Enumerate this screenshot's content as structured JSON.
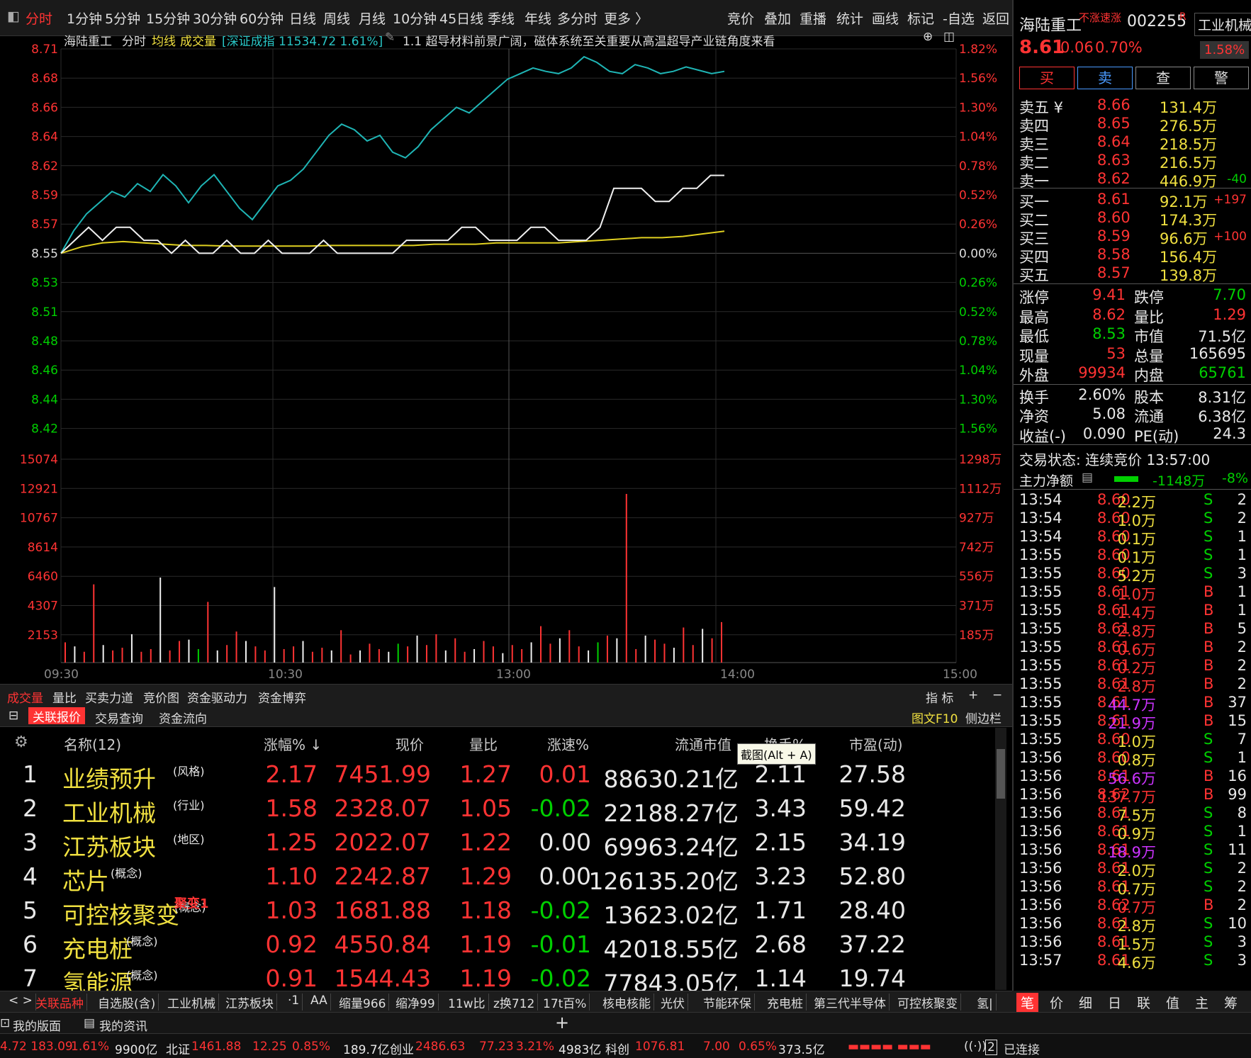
{
  "toolbar": {
    "periods": [
      "分时",
      "1分钟",
      "5分钟",
      "15分钟",
      "30分钟",
      "60分钟",
      "日线",
      "周线",
      "月线",
      "10分钟",
      "45日线",
      "季线",
      "年线",
      "多分时",
      "更多 〉"
    ],
    "actions": [
      "竞价",
      "叠加",
      "重播",
      "统计",
      "画线",
      "标记",
      "-自选",
      "返回"
    ]
  },
  "infobar": {
    "stock": "海陆重工",
    "mode": "分时",
    "avg_label": "均线",
    "vol_label": "成交量",
    "index_info": "[深证成指 11534.72 1.61%]",
    "news": "1.1 超导材料前景广阔，磁体系统至关重要从高温超导产业链角度来看"
  },
  "chart_data": {
    "type": "line",
    "price_axis": [
      "8.71",
      "8.68",
      "8.66",
      "8.64",
      "8.62",
      "8.59",
      "8.57",
      "8.55",
      "8.53",
      "8.51",
      "8.48",
      "8.46",
      "8.44",
      "8.42"
    ],
    "pct_axis": [
      "1.82%",
      "1.56%",
      "1.30%",
      "1.04%",
      "0.78%",
      "0.52%",
      "0.26%",
      "0.00%",
      "0.26%",
      "0.52%",
      "0.78%",
      "1.04%",
      "1.30%",
      "1.56%"
    ],
    "vol_axis": [
      "15074",
      "12921",
      "10767",
      "8614",
      "6460",
      "4307",
      "2153"
    ],
    "vol_axis_right": [
      "1298万",
      "1112万",
      "927万",
      "742万",
      "556万",
      "371万",
      "185万"
    ],
    "time_labels": [
      "09:30",
      "10:30",
      "13:00",
      "14:00",
      "15:00"
    ],
    "prev_close": 8.55,
    "index_series": [
      0.0,
      0.2,
      0.35,
      0.45,
      0.55,
      0.5,
      0.62,
      0.55,
      0.7,
      0.6,
      0.45,
      0.6,
      0.7,
      0.55,
      0.4,
      0.3,
      0.45,
      0.6,
      0.65,
      0.75,
      0.9,
      1.05,
      1.15,
      1.1,
      1.0,
      1.05,
      0.9,
      0.85,
      0.95,
      1.1,
      1.2,
      1.3,
      1.25,
      1.35,
      1.45,
      1.55,
      1.6,
      1.65,
      1.62,
      1.6,
      1.65,
      1.75,
      1.7,
      1.62,
      1.6,
      1.68,
      1.65,
      1.6,
      1.62,
      1.66,
      1.63,
      1.6,
      1.62
    ],
    "price_series": [
      8.55,
      8.56,
      8.57,
      8.56,
      8.57,
      8.57,
      8.56,
      8.56,
      8.55,
      8.56,
      8.55,
      8.55,
      8.56,
      8.55,
      8.55,
      8.56,
      8.55,
      8.55,
      8.55,
      8.56,
      8.55,
      8.55,
      8.55,
      8.55,
      8.55,
      8.56,
      8.56,
      8.56,
      8.56,
      8.57,
      8.57,
      8.56,
      8.56,
      8.56,
      8.57,
      8.57,
      8.56,
      8.56,
      8.56,
      8.57,
      8.6,
      8.6,
      8.6,
      8.59,
      8.59,
      8.6,
      8.6,
      8.61,
      8.61
    ],
    "avg_series": [
      8.55,
      8.555,
      8.558,
      8.559,
      8.558,
      8.557,
      8.556,
      8.556,
      8.5555,
      8.5555,
      8.5555,
      8.5555,
      8.5555,
      8.556,
      8.556,
      8.556,
      8.556,
      8.556,
      8.557,
      8.557,
      8.557,
      8.558,
      8.558,
      8.558,
      8.558,
      8.559,
      8.56,
      8.561,
      8.562,
      8.562,
      8.563,
      8.565,
      8.567
    ],
    "volumes": [
      1500,
      1200,
      800,
      5800,
      1300,
      900,
      1100,
      2100,
      800,
      1000,
      6300,
      900,
      1600,
      1700,
      1000,
      4500,
      900,
      1300,
      2300,
      1600,
      1200,
      900,
      5600,
      1000,
      1200,
      1600,
      800,
      1100,
      900,
      2400,
      600,
      900,
      1400,
      1000,
      800,
      1400,
      1200,
      2000,
      1300,
      2100,
      900,
      1800,
      800,
      1000,
      1600,
      1200,
      700,
      1300,
      1000,
      1500,
      2700,
      1400,
      1800,
      2400,
      1200,
      900,
      1500,
      2000,
      1800,
      12500,
      1000,
      2000,
      1700,
      1400,
      1100,
      2600,
      1300,
      2500,
      1800,
      3000
    ]
  },
  "lower_tabs": [
    "成交量",
    "量比",
    "买卖力道",
    "竞价图",
    "资金驱动力",
    "资金博弈"
  ],
  "lower_right": [
    "指 标",
    "+",
    "−"
  ],
  "table_tabs": [
    "关联报价",
    "交易查询",
    "资金流向"
  ],
  "table_right": [
    "图文F10",
    "侧边栏"
  ],
  "table": {
    "headers": [
      "名称(12)",
      "涨幅% ↓",
      "现价",
      "量比",
      "涨速%",
      "流通市值",
      "换手%",
      "市盈(动)"
    ],
    "tooltip": "截图(Alt + A)",
    "rows": [
      {
        "n": "1",
        "name": "业绩预升",
        "tag": "(风格)",
        "chg": "2.17",
        "price": "7451.99",
        "qr": "1.27",
        "spd": "0.01",
        "cap": "88630.21亿",
        "turn": "2.11",
        "pe": "27.58"
      },
      {
        "n": "2",
        "name": "工业机械",
        "tag": "(行业)",
        "chg": "1.58",
        "price": "2328.07",
        "qr": "1.05",
        "spd": "-0.02",
        "cap": "22188.27亿",
        "turn": "3.43",
        "pe": "59.42"
      },
      {
        "n": "3",
        "name": "江苏板块",
        "tag": "(地区)",
        "chg": "1.25",
        "price": "2022.07",
        "qr": "1.22",
        "spd": "0.00",
        "cap": "69963.24亿",
        "turn": "2.15",
        "pe": "34.19"
      },
      {
        "n": "4",
        "name": "芯片",
        "tag": "(概念)",
        "chg": "1.10",
        "price": "2242.87",
        "qr": "1.29",
        "spd": "0.00",
        "cap": "126135.20亿",
        "turn": "3.23",
        "pe": "52.80"
      },
      {
        "n": "5",
        "name": "可控核聚变",
        "tag": "(概念)",
        "extra": "聚变1",
        "chg": "1.03",
        "price": "1681.88",
        "qr": "1.18",
        "spd": "-0.02",
        "cap": "13623.02亿",
        "turn": "1.71",
        "pe": "28.40"
      },
      {
        "n": "6",
        "name": "充电桩",
        "tag": "(概念)",
        "chg": "0.92",
        "price": "4550.84",
        "qr": "1.19",
        "spd": "-0.01",
        "cap": "42018.55亿",
        "turn": "2.68",
        "pe": "37.22"
      },
      {
        "n": "7",
        "name": "氢能源",
        "tag": "(概念)",
        "chg": "0.91",
        "price": "1544.43",
        "qr": "1.19",
        "spd": "-0.02",
        "cap": "77843.05亿",
        "turn": "1.14",
        "pe": "19.74"
      }
    ]
  },
  "bottom_tabs": [
    "< >",
    "关联品种",
    "自选股(含)",
    "工业机械",
    "江苏板块",
    "·1",
    "AA",
    "缩量966",
    "缩净99",
    "11w比",
    "z换712",
    "17t百%",
    "核电核能",
    "光伏",
    "节能环保",
    "充电桩",
    "第三代半导体",
    "可控核聚变",
    "氢|"
  ],
  "workspace": {
    "a": "我的版面",
    "b": "我的资讯",
    "plus": "+"
  },
  "status": [
    {
      "t": "4.72 183.09",
      "c": "red"
    },
    {
      "t": "1.61%",
      "c": "red"
    },
    {
      "t": "9900亿",
      "c": "white"
    },
    {
      "t": "北证",
      "c": "white"
    },
    {
      "t": "1461.88",
      "c": "red"
    },
    {
      "t": "12.25",
      "c": "red"
    },
    {
      "t": "0.85%",
      "c": "red"
    },
    {
      "t": "189.7亿",
      "c": "white"
    },
    {
      "t": "创业",
      "c": "white"
    },
    {
      "t": "2486.63",
      "c": "red"
    },
    {
      "t": "77.23",
      "c": "red"
    },
    {
      "t": "3.21%",
      "c": "red"
    },
    {
      "t": "4983亿",
      "c": "white"
    },
    {
      "t": "科创",
      "c": "white"
    },
    {
      "t": "1076.81",
      "c": "red"
    },
    {
      "t": "7.00",
      "c": "red"
    },
    {
      "t": "0.65%",
      "c": "red"
    },
    {
      "t": "373.5亿",
      "c": "white"
    }
  ],
  "status_right": {
    "num": "2",
    "conn": "已连接"
  },
  "quote": {
    "name": "海陆重工",
    "tag": "不涨速涨",
    "code": "002255",
    "r": "R",
    "sector": "工业机械",
    "price": "8.61",
    "chg": "0.06",
    "pct": "0.70%",
    "sector_pct": "1.58%",
    "buttons": [
      "买",
      "卖",
      "查",
      "警"
    ]
  },
  "asks": [
    {
      "l": "卖五 ¥",
      "p": "8.66",
      "v": "131.4万",
      "d": ""
    },
    {
      "l": "卖四",
      "p": "8.65",
      "v": "276.5万",
      "d": ""
    },
    {
      "l": "卖三",
      "p": "8.64",
      "v": "218.5万",
      "d": ""
    },
    {
      "l": "卖二",
      "p": "8.63",
      "v": "216.5万",
      "d": ""
    },
    {
      "l": "卖一",
      "p": "8.62",
      "v": "446.9万",
      "d": "-40"
    }
  ],
  "bids": [
    {
      "l": "买一",
      "p": "8.61",
      "v": "92.1万",
      "d": "+197"
    },
    {
      "l": "买二",
      "p": "8.60",
      "v": "174.3万",
      "d": ""
    },
    {
      "l": "买三",
      "p": "8.59",
      "v": "96.6万",
      "d": "+100"
    },
    {
      "l": "买四",
      "p": "8.58",
      "v": "156.4万",
      "d": ""
    },
    {
      "l": "买五",
      "p": "8.57",
      "v": "139.8万",
      "d": ""
    }
  ],
  "stats": [
    {
      "a": "涨停",
      "av": "9.41",
      "ac": "red",
      "b": "跌停",
      "bv": "7.70",
      "bc": "green"
    },
    {
      "a": "最高",
      "av": "8.62",
      "ac": "red",
      "b": "量比",
      "bv": "1.29",
      "bc": "red"
    },
    {
      "a": "最低",
      "av": "8.53",
      "ac": "green",
      "b": "市值",
      "bv": "71.5亿",
      "bc": "white"
    },
    {
      "a": "现量",
      "av": "53",
      "ac": "red",
      "b": "总量",
      "bv": "165695",
      "bc": "white"
    },
    {
      "a": "外盘",
      "av": "99934",
      "ac": "red",
      "b": "内盘",
      "bv": "65761",
      "bc": "green"
    },
    {
      "a": "换手",
      "av": "2.60%",
      "ac": "white",
      "b": "股本",
      "bv": "8.31亿",
      "bc": "white"
    },
    {
      "a": "净资",
      "av": "5.08",
      "ac": "white",
      "b": "流通",
      "bv": "6.38亿",
      "bc": "white"
    },
    {
      "a": "收益(-)",
      "av": "0.090",
      "ac": "white",
      "b": "PE(动)",
      "bv": "24.3",
      "bc": "white"
    }
  ],
  "trade_state": "交易状态: 连续竞价 13:57:00",
  "main_force": {
    "label": "主力净额",
    "value": "-1148万",
    "pct": "-8%"
  },
  "ticks": [
    [
      "13:54",
      "8.60",
      "2.2万",
      "S",
      "2"
    ],
    [
      "13:54",
      "8.60",
      "1.0万",
      "S",
      "2"
    ],
    [
      "13:54",
      "8.60",
      "0.1万",
      "S",
      "1"
    ],
    [
      "13:55",
      "8.60",
      "0.1万",
      "S",
      "1"
    ],
    [
      "13:55",
      "8.60",
      "5.2万",
      "S",
      "3"
    ],
    [
      "13:55",
      "8.61",
      "1.0万",
      "B",
      "1"
    ],
    [
      "13:55",
      "8.61",
      "1.4万",
      "B",
      "1"
    ],
    [
      "13:55",
      "8.61",
      "2.8万",
      "B",
      "5"
    ],
    [
      "13:55",
      "8.61",
      "0.6万",
      "B",
      "2"
    ],
    [
      "13:55",
      "8.61",
      "0.2万",
      "B",
      "2"
    ],
    [
      "13:55",
      "8.61",
      "2.8万",
      "B",
      "2"
    ],
    [
      "13:55",
      "8.61",
      "44.7万",
      "B",
      "37"
    ],
    [
      "13:55",
      "8.61",
      "21.9万",
      "B",
      "15"
    ],
    [
      "13:55",
      "8.60",
      "1.0万",
      "S",
      "7"
    ],
    [
      "13:56",
      "8.60",
      "0.8万",
      "S",
      "1"
    ],
    [
      "13:56",
      "8.61",
      "56.6万",
      "B",
      "16"
    ],
    [
      "13:56",
      "8.62",
      "137.7万",
      "B",
      "99"
    ],
    [
      "13:56",
      "8.61",
      "7.5万",
      "S",
      "8"
    ],
    [
      "13:56",
      "8.61",
      "0.9万",
      "S",
      "1"
    ],
    [
      "13:56",
      "8.61",
      "18.9万",
      "S",
      "11"
    ],
    [
      "13:56",
      "8.61",
      "2.0万",
      "S",
      "2"
    ],
    [
      "13:56",
      "8.61",
      "0.7万",
      "S",
      "2"
    ],
    [
      "13:56",
      "8.62",
      "0.7万",
      "B",
      "2"
    ],
    [
      "13:56",
      "8.61",
      "2.8万",
      "S",
      "10"
    ],
    [
      "13:56",
      "8.61",
      "1.5万",
      "S",
      "3"
    ],
    [
      "13:57",
      "8.61",
      "4.6万",
      "S",
      "3"
    ]
  ],
  "right_tabs": [
    "笔",
    "价",
    "细",
    "日",
    "联",
    "值",
    "主",
    "筹"
  ]
}
